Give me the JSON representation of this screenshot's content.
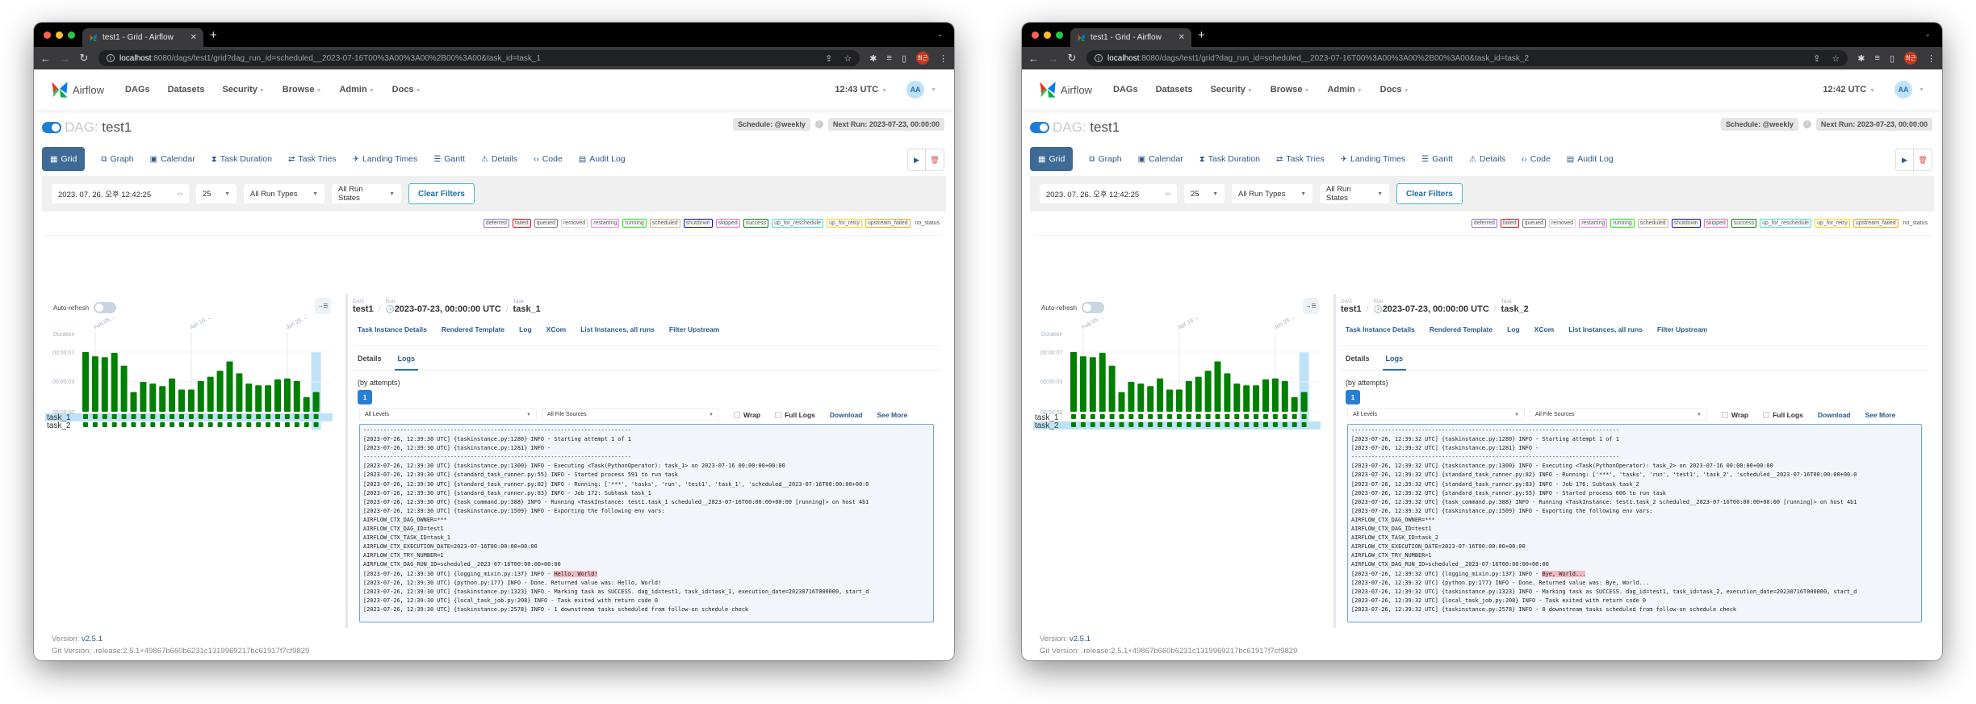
{
  "windows": [
    {
      "tab_title": "test1 - Grid - Airflow",
      "url_host": "localhost",
      "url_rest": ":8080/dags/test1/grid?dag_run_id=scheduled__2023-07-16T00%3A00%3A00%2B00%3A00&task_id=task_1",
      "profile_initials": "최근",
      "nav": {
        "brand": "Airflow",
        "items": [
          "DAGs",
          "Datasets",
          "Security",
          "Browse",
          "Admin",
          "Docs"
        ],
        "clock": "12:43 UTC",
        "avatar": "AA"
      },
      "dag": {
        "label": "DAG:",
        "name": "test1",
        "schedule": "Schedule: @weekly",
        "next_run": "Next Run: 2023-07-23, 00:00:00"
      },
      "views": [
        "Grid",
        "Graph",
        "Calendar",
        "Task Duration",
        "Task Tries",
        "Landing Times",
        "Gantt",
        "Details",
        "Code",
        "Audit Log"
      ],
      "active_view": "Grid",
      "filters": {
        "date": "2023. 07. 26. 오후 12:42:25",
        "num_runs": "25",
        "run_type": "All Run Types",
        "run_state": "All Run States",
        "clear": "Clear Filters"
      },
      "legend": [
        {
          "label": "deferred",
          "color": "#9370db"
        },
        {
          "label": "failed",
          "color": "#ff0000"
        },
        {
          "label": "queued",
          "color": "#808080"
        },
        {
          "label": "removed",
          "color": "#d3d3d3"
        },
        {
          "label": "restarting",
          "color": "#ee82ee"
        },
        {
          "label": "running",
          "color": "#00ff00"
        },
        {
          "label": "scheduled",
          "color": "#d2b48c"
        },
        {
          "label": "shutdown",
          "color": "#0000ff"
        },
        {
          "label": "skipped",
          "color": "#ff69b4"
        },
        {
          "label": "success",
          "color": "#008000"
        },
        {
          "label": "up_for_reschedule",
          "color": "#40e0d0"
        },
        {
          "label": "up_for_retry",
          "color": "#ffd700"
        },
        {
          "label": "upstream_failed",
          "color": "#ffa500"
        },
        {
          "label": "no_status",
          "color": "transparent"
        }
      ],
      "grid": {
        "auto_refresh": "Auto-refresh",
        "duration_label": "Duration",
        "y_ticks": [
          "00:00:07",
          "00:00:03",
          "00:00:00"
        ],
        "date_ticks": [
          {
            "label": "Feb 05, 00:00",
            "run_index": 1
          },
          {
            "label": "Apr 16, 00:00",
            "run_index": 11
          },
          {
            "label": "Jun 25, 00:00",
            "run_index": 21
          }
        ],
        "durations_sec": [
          7.0,
          6.5,
          6.4,
          6.9,
          5.4,
          2.3,
          3.5,
          3.3,
          3.0,
          3.9,
          2.6,
          2.6,
          3.6,
          4.1,
          4.8,
          5.9,
          4.5,
          3.3,
          3.1,
          3.1,
          3.8,
          3.9,
          3.6,
          1.7,
          2.3
        ],
        "max_sec": 7.0,
        "selected_run_index": 24,
        "tasks": [
          {
            "name": "task_1",
            "state": "success"
          },
          {
            "name": "task_2",
            "state": "success"
          }
        ],
        "selected_task": "task_1"
      },
      "details": {
        "dag_key": "DAG",
        "dag_val": "test1",
        "run_key": "Run",
        "run_val": "2023-07-23, 00:00:00 UTC",
        "task_key": "Task",
        "task_val": "task_1",
        "links": [
          "Task Instance Details",
          "Rendered Template",
          "Log",
          "XCom",
          "List Instances, all runs",
          "Filter Upstream"
        ],
        "subtabs": [
          "Details",
          "Logs"
        ],
        "by_attempts": "(by attempts)",
        "attempt": "1",
        "level_select": "All Levels",
        "source_select": "All File Sources",
        "wrap": "Wrap",
        "full_logs": "Full Logs",
        "download": "Download",
        "see_more": "See More",
        "log_lines": [
          "--------------------------------------------------------------------------------",
          "[2023-07-26, 12:39:30 UTC] {taskinstance.py:1280} INFO - Starting attempt 1 of 1",
          "[2023-07-26, 12:39:30 UTC] {taskinstance.py:1281} INFO - ",
          "--------------------------------------------------------------------------------",
          "[2023-07-26, 12:39:30 UTC] {taskinstance.py:1300} INFO - Executing <Task(PythonOperator): task_1> on 2023-07-16 00:00:00+00:00",
          "[2023-07-26, 12:39:30 UTC] {standard_task_runner.py:55} INFO - Started process 591 to run task",
          "[2023-07-26, 12:39:30 UTC] {standard_task_runner.py:82} INFO - Running: ['***', 'tasks', 'run', 'test1', 'task_1', 'scheduled__2023-07-16T00:00:00+00:0",
          "[2023-07-26, 12:39:30 UTC] {standard_task_runner.py:83} INFO - Job 172: Subtask task_1",
          "[2023-07-26, 12:39:30 UTC] {task_command.py:388} INFO - Running <TaskInstance: test1.task_1 scheduled__2023-07-16T00:00:00+00:00 [running]> on host 4b1",
          "[2023-07-26, 12:39:30 UTC] {taskinstance.py:1509} INFO - Exporting the following env vars:",
          "AIRFLOW_CTX_DAG_OWNER=***",
          "AIRFLOW_CTX_DAG_ID=test1",
          "AIRFLOW_CTX_TASK_ID=task_1",
          "AIRFLOW_CTX_EXECUTION_DATE=2023-07-16T00:00:00+00:00",
          "AIRFLOW_CTX_TRY_NUMBER=1",
          "AIRFLOW_CTX_DAG_RUN_ID=scheduled__2023-07-16T00:00:00+00:00",
          "[2023-07-26, 12:39:30 UTC] {logging_mixin.py:137} INFO - ",
          "[2023-07-26, 12:39:30 UTC] {python.py:177} INFO - Done. Returned value was: Hello, World!",
          "[2023-07-26, 12:39:30 UTC] {taskinstance.py:1323} INFO - Marking task as SUCCESS. dag_id=test1, task_id=task_1, execution_date=20230716T000000, start_d",
          "[2023-07-26, 12:39:30 UTC] {local_task_job.py:208} INFO - Task exited with return code 0",
          "[2023-07-26, 12:39:30 UTC] {taskinstance.py:2578} INFO - 1 downstream tasks scheduled from follow-on schedule check"
        ],
        "highlight_line_index": 16,
        "highlight_text": "Hello, World!"
      },
      "footer": {
        "version_label": "Version:",
        "version": "v2.5.1",
        "git": "Git Version: .release:2.5.1+49867b660b6231c1319969217bc61917f7cf9829"
      }
    },
    {
      "tab_title": "test1 - Grid - Airflow",
      "url_host": "localhost",
      "url_rest": ":8080/dags/test1/grid?dag_run_id=scheduled__2023-07-16T00%3A00%3A00%2B00%3A00&task_id=task_2",
      "profile_initials": "최근",
      "nav": {
        "brand": "Airflow",
        "items": [
          "DAGs",
          "Datasets",
          "Security",
          "Browse",
          "Admin",
          "Docs"
        ],
        "clock": "12:42 UTC",
        "avatar": "AA"
      },
      "dag": {
        "label": "DAG:",
        "name": "test1",
        "schedule": "Schedule: @weekly",
        "next_run": "Next Run: 2023-07-23, 00:00:00"
      },
      "views": [
        "Grid",
        "Graph",
        "Calendar",
        "Task Duration",
        "Task Tries",
        "Landing Times",
        "Gantt",
        "Details",
        "Code",
        "Audit Log"
      ],
      "active_view": "Grid",
      "filters": {
        "date": "2023. 07. 26. 오후 12:42:25",
        "num_runs": "25",
        "run_type": "All Run Types",
        "run_state": "All Run States",
        "clear": "Clear Filters"
      },
      "legend": [
        {
          "label": "deferred",
          "color": "#9370db"
        },
        {
          "label": "failed",
          "color": "#ff0000"
        },
        {
          "label": "queued",
          "color": "#808080"
        },
        {
          "label": "removed",
          "color": "#d3d3d3"
        },
        {
          "label": "restarting",
          "color": "#ee82ee"
        },
        {
          "label": "running",
          "color": "#00ff00"
        },
        {
          "label": "scheduled",
          "color": "#d2b48c"
        },
        {
          "label": "shutdown",
          "color": "#0000ff"
        },
        {
          "label": "skipped",
          "color": "#ff69b4"
        },
        {
          "label": "success",
          "color": "#008000"
        },
        {
          "label": "up_for_reschedule",
          "color": "#40e0d0"
        },
        {
          "label": "up_for_retry",
          "color": "#ffd700"
        },
        {
          "label": "upstream_failed",
          "color": "#ffa500"
        },
        {
          "label": "no_status",
          "color": "transparent"
        }
      ],
      "grid": {
        "auto_refresh": "Auto-refresh",
        "duration_label": "Duration",
        "y_ticks": [
          "00:00:07",
          "00:00:03",
          "00:00:00"
        ],
        "date_ticks": [
          {
            "label": "Feb 05, 00:00",
            "run_index": 1
          },
          {
            "label": "Apr 16, 00:00",
            "run_index": 11
          },
          {
            "label": "Jun 25, 00:00",
            "run_index": 21
          }
        ],
        "durations_sec": [
          7.0,
          6.5,
          6.4,
          6.9,
          5.4,
          2.3,
          3.5,
          3.3,
          3.0,
          3.9,
          2.6,
          2.6,
          3.6,
          4.1,
          4.8,
          5.9,
          4.5,
          3.3,
          3.1,
          3.1,
          3.8,
          3.9,
          3.6,
          1.7,
          2.3
        ],
        "max_sec": 7.0,
        "selected_run_index": 24,
        "tasks": [
          {
            "name": "task_1",
            "state": "success"
          },
          {
            "name": "task_2",
            "state": "success"
          }
        ],
        "selected_task": "task_2"
      },
      "details": {
        "dag_key": "DAG",
        "dag_val": "test1",
        "run_key": "Run",
        "run_val": "2023-07-23, 00:00:00 UTC",
        "task_key": "Task",
        "task_val": "task_2",
        "links": [
          "Task Instance Details",
          "Rendered Template",
          "Log",
          "XCom",
          "List Instances, all runs",
          "Filter Upstream"
        ],
        "subtabs": [
          "Details",
          "Logs"
        ],
        "by_attempts": "(by attempts)",
        "attempt": "1",
        "level_select": "All Levels",
        "source_select": "All File Sources",
        "wrap": "Wrap",
        "full_logs": "Full Logs",
        "download": "Download",
        "see_more": "See More",
        "log_lines": [
          "--------------------------------------------------------------------------------",
          "[2023-07-26, 12:39:32 UTC] {taskinstance.py:1280} INFO - Starting attempt 1 of 1",
          "[2023-07-26, 12:39:32 UTC] {taskinstance.py:1281} INFO - ",
          "--------------------------------------------------------------------------------",
          "[2023-07-26, 12:39:32 UTC] {taskinstance.py:1300} INFO - Executing <Task(PythonOperator): task_2> on 2023-07-16 00:00:00+00:00",
          "[2023-07-26, 12:39:32 UTC] {standard_task_runner.py:82} INFO - Running: ['***', 'tasks', 'run', 'test1', 'task_2', 'scheduled__2023-07-16T00:00:00+00:0",
          "[2023-07-26, 12:39:32 UTC] {standard_task_runner.py:83} INFO - Job 176: Subtask task_2",
          "[2023-07-26, 12:39:32 UTC] {standard_task_runner.py:55} INFO - Started process 606 to run task",
          "[2023-07-26, 12:39:32 UTC] {task_command.py:388} INFO - Running <TaskInstance: test1.task_2 scheduled__2023-07-16T00:00:00+00:00 [running]> on host 4b1",
          "[2023-07-26, 12:39:32 UTC] {taskinstance.py:1509} INFO - Exporting the following env vars:",
          "AIRFLOW_CTX_DAG_OWNER=***",
          "AIRFLOW_CTX_DAG_ID=test1",
          "AIRFLOW_CTX_TASK_ID=task_2",
          "AIRFLOW_CTX_EXECUTION_DATE=2023-07-16T00:00:00+00:00",
          "AIRFLOW_CTX_TRY_NUMBER=1",
          "AIRFLOW_CTX_DAG_RUN_ID=scheduled__2023-07-16T00:00:00+00:00",
          "[2023-07-26, 12:39:32 UTC] {logging_mixin.py:137} INFO - ",
          "[2023-07-26, 12:39:32 UTC] {python.py:177} INFO - Done. Returned value was: Bye, World...",
          "[2023-07-26, 12:39:32 UTC] {taskinstance.py:1323} INFO - Marking task as SUCCESS. dag_id=test1, task_id=task_2, execution_date=20230716T000000, start_d",
          "[2023-07-26, 12:39:32 UTC] {local_task_job.py:208} INFO - Task exited with return code 0",
          "[2023-07-26, 12:39:32 UTC] {taskinstance.py:2578} INFO - 0 downstream tasks scheduled from follow-on schedule check"
        ],
        "highlight_line_index": 16,
        "highlight_text": "Bye, World..."
      },
      "footer": {
        "version_label": "Version:",
        "version": "v2.5.1",
        "git": "Git Version: .release:2.5.1+49867b660b6231c1319969217bc61917f7cf9829"
      }
    }
  ]
}
